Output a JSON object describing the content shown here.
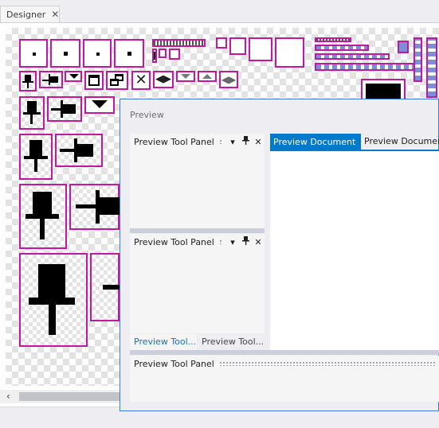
{
  "designer": {
    "tab_label": "Designer",
    "tab_close": "✕",
    "scroll_left": "‹"
  },
  "preview": {
    "title": "Preview",
    "top_panel": {
      "title": "Preview Tool Panel",
      "menu_icon": "▾",
      "pin_icon": "📌",
      "close_icon": "✕"
    },
    "middle_panel": {
      "title": "Preview Tool Panel",
      "menu_icon": "▾",
      "pin_icon": "📌",
      "close_icon": "✕"
    },
    "bottom_tabs": [
      "Preview Tool...",
      "Preview Tool..."
    ],
    "bottom_panel": {
      "title": "Preview Tool Panel"
    },
    "doc_tabs": [
      {
        "label": "Preview Document",
        "close": "✕"
      },
      {
        "label": "Preview Document"
      }
    ]
  },
  "colors": {
    "accent": "#007acc",
    "glyph_border": "#c0189e",
    "window_border": "#3d7bd6"
  }
}
